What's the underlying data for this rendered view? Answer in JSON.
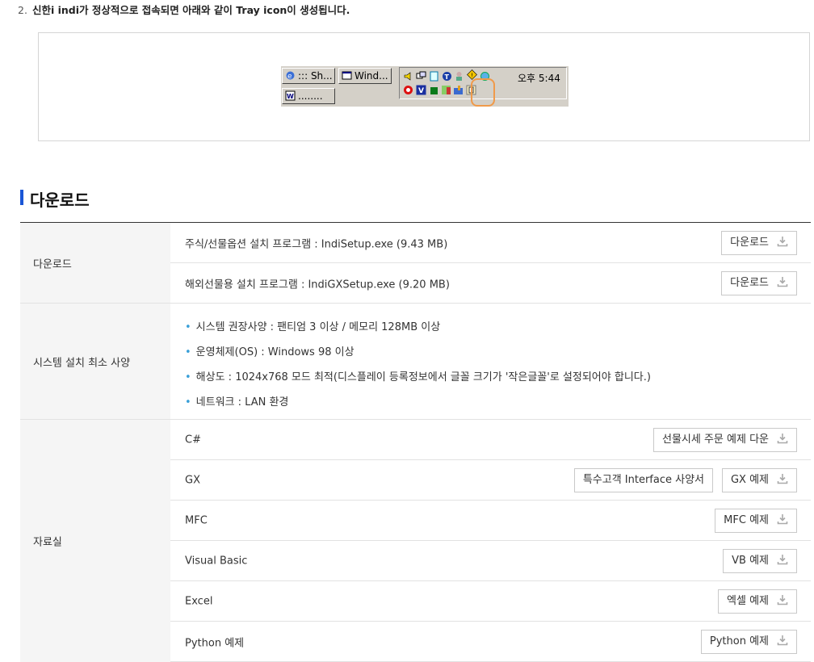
{
  "step": {
    "number": "2.",
    "text": "신한i indi가 정상적으로 접속되면 아래와 같이 Tray icon이 생성됩니다."
  },
  "tray": {
    "btn1": "::: Sh...",
    "btn2": "Wind...",
    "btn3": "........",
    "clock": "오후 5:44"
  },
  "section": {
    "title": "다운로드"
  },
  "download": {
    "header": "다운로드",
    "items": [
      {
        "label": "주식/선물옵션 설치 프로그램 : IndiSetup.exe (9.43 MB)",
        "button": "다운로드"
      },
      {
        "label": "해외선물용 설치 프로그램 : IndiGXSetup.exe (9.20 MB)",
        "button": "다운로드"
      }
    ]
  },
  "requirements": {
    "header": "시스템 설치 최소 사양",
    "items": [
      "시스템 권장사양 : 팬티엄 3 이상 / 메모리 128MB 이상",
      "운영체제(OS) : Windows 98 이상",
      "해상도 : 1024x768 모드 최적(디스플레이 등록정보에서 글꼴 크기가 '작은글꼴'로 설정되어야 합니다.)",
      "네트워크 : LAN 환경"
    ]
  },
  "library": {
    "header": "자료실",
    "items": [
      {
        "label": "C#",
        "buttons": [
          "선물시세 주문 예제 다운"
        ]
      },
      {
        "label": "GX",
        "buttons": [
          "특수고객 Interface 사양서",
          "GX 예제"
        ]
      },
      {
        "label": "MFC",
        "buttons": [
          "MFC 예제"
        ]
      },
      {
        "label": "Visual Basic",
        "buttons": [
          "VB 예제"
        ]
      },
      {
        "label": "Excel",
        "buttons": [
          "엑셀 예제"
        ]
      },
      {
        "label": "Python 예제",
        "buttons": [
          "Python 예제"
        ]
      }
    ]
  },
  "colors": {
    "accent": "#1a56d6",
    "highlight": "#f09a4a",
    "bullet": "#3aa0d8"
  }
}
